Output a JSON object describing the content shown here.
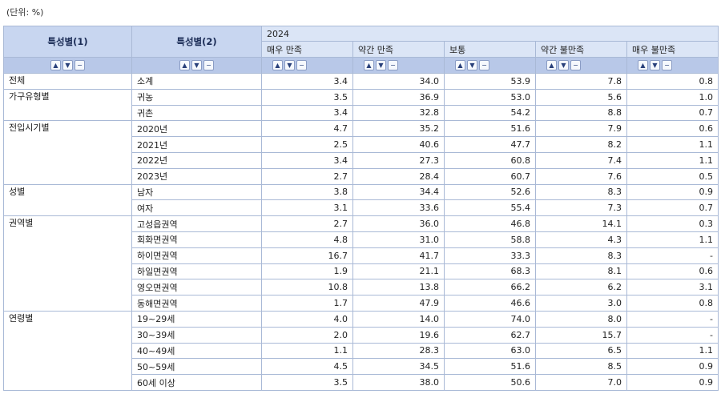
{
  "unit_label": "(단위: %)",
  "header": {
    "char1": "특성별(1)",
    "char2": "특성별(2)",
    "year": "2024",
    "columns": [
      "매우 만족",
      "약간 만족",
      "보통",
      "약간 불만족",
      "매우 불만족"
    ]
  },
  "sort_buttons": {
    "asc": "▲",
    "desc": "▼",
    "reset": "−"
  },
  "groups": [
    {
      "label": "전체",
      "rows": [
        {
          "sub": "소계",
          "values": [
            "3.4",
            "34.0",
            "53.9",
            "7.8",
            "0.8"
          ]
        }
      ]
    },
    {
      "label": "가구유형별",
      "rows": [
        {
          "sub": "귀농",
          "values": [
            "3.5",
            "36.9",
            "53.0",
            "5.6",
            "1.0"
          ]
        },
        {
          "sub": "귀촌",
          "values": [
            "3.4",
            "32.8",
            "54.2",
            "8.8",
            "0.7"
          ]
        }
      ]
    },
    {
      "label": "전입시기별",
      "rows": [
        {
          "sub": "2020년",
          "values": [
            "4.7",
            "35.2",
            "51.6",
            "7.9",
            "0.6"
          ]
        },
        {
          "sub": "2021년",
          "values": [
            "2.5",
            "40.6",
            "47.7",
            "8.2",
            "1.1"
          ]
        },
        {
          "sub": "2022년",
          "values": [
            "3.4",
            "27.3",
            "60.8",
            "7.4",
            "1.1"
          ]
        },
        {
          "sub": "2023년",
          "values": [
            "2.7",
            "28.4",
            "60.7",
            "7.6",
            "0.5"
          ]
        }
      ]
    },
    {
      "label": "성별",
      "rows": [
        {
          "sub": "남자",
          "values": [
            "3.8",
            "34.4",
            "52.6",
            "8.3",
            "0.9"
          ]
        },
        {
          "sub": "여자",
          "values": [
            "3.1",
            "33.6",
            "55.4",
            "7.3",
            "0.7"
          ]
        }
      ]
    },
    {
      "label": "권역별",
      "rows": [
        {
          "sub": "고성읍권역",
          "values": [
            "2.7",
            "36.0",
            "46.8",
            "14.1",
            "0.3"
          ]
        },
        {
          "sub": "회화면권역",
          "values": [
            "4.8",
            "31.0",
            "58.8",
            "4.3",
            "1.1"
          ]
        },
        {
          "sub": "하이면권역",
          "values": [
            "16.7",
            "41.7",
            "33.3",
            "8.3",
            "-"
          ]
        },
        {
          "sub": "하일면권역",
          "values": [
            "1.9",
            "21.1",
            "68.3",
            "8.1",
            "0.6"
          ]
        },
        {
          "sub": "영오면권역",
          "values": [
            "10.8",
            "13.8",
            "66.2",
            "6.2",
            "3.1"
          ]
        },
        {
          "sub": "동해면권역",
          "values": [
            "1.7",
            "47.9",
            "46.6",
            "3.0",
            "0.8"
          ]
        }
      ]
    },
    {
      "label": "연령별",
      "rows": [
        {
          "sub": "19~29세",
          "values": [
            "4.0",
            "14.0",
            "74.0",
            "8.0",
            "-"
          ]
        },
        {
          "sub": "30~39세",
          "values": [
            "2.0",
            "19.6",
            "62.7",
            "15.7",
            "-"
          ]
        },
        {
          "sub": "40~49세",
          "values": [
            "1.1",
            "28.3",
            "63.0",
            "6.5",
            "1.1"
          ]
        },
        {
          "sub": "50~59세",
          "values": [
            "4.5",
            "34.5",
            "51.6",
            "8.5",
            "0.9"
          ]
        },
        {
          "sub": "60세 이상",
          "values": [
            "3.5",
            "38.0",
            "50.6",
            "7.0",
            "0.9"
          ]
        }
      ]
    }
  ]
}
